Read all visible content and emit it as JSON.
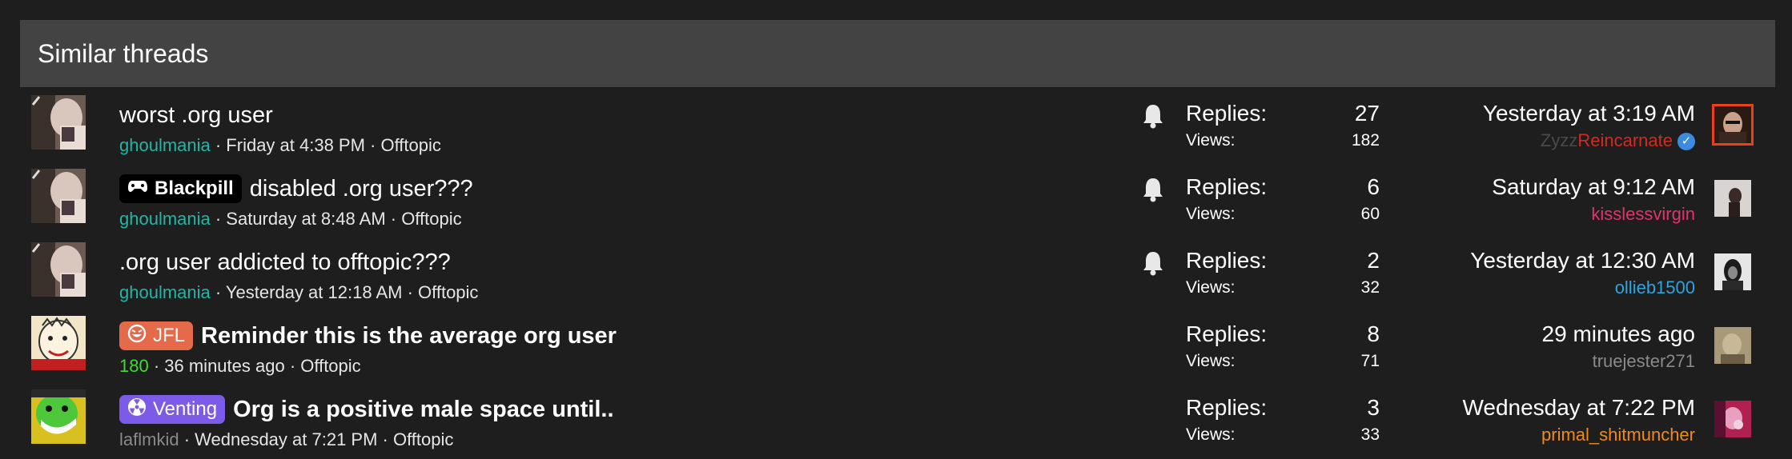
{
  "header": {
    "title": "Similar threads"
  },
  "labels": {
    "replies": "Replies:",
    "views": "Views:"
  },
  "threads": [
    {
      "title": "worst .org user",
      "author": "ghoulmania",
      "meta_rest": " · Friday at 4:38 PM · Offtopic",
      "replies": "27",
      "views": "182",
      "last_date": "Yesterday at 3:19 AM",
      "last_user_a": "Zyzz",
      "last_user_b": "Reincarnate",
      "colors": {
        "author": "#22b5a5",
        "last_user_a": "#4a4a4a",
        "last_user_b": "#d42a1f"
      }
    },
    {
      "prefix": "Blackpill",
      "title": "disabled .org user???",
      "author": "ghoulmania",
      "meta_rest": " · Saturday at 8:48 AM · Offtopic",
      "replies": "6",
      "views": "60",
      "last_date": "Saturday at 9:12 AM",
      "last_user": "kisslessvirgin",
      "colors": {
        "author": "#22b5a5",
        "last_user": "#e0356a",
        "prefix_bg": "#000000"
      }
    },
    {
      "title": ".org user addicted to offtopic???",
      "author": "ghoulmania",
      "meta_rest": " · Yesterday at 12:18 AM · Offtopic",
      "replies": "2",
      "views": "32",
      "last_date": "Yesterday at 12:30 AM",
      "last_user": "ollieb1500",
      "colors": {
        "author": "#22b5a5",
        "last_user": "#2aa5e0"
      }
    },
    {
      "prefix": "JFL",
      "title": "Reminder this is the average org user",
      "author": "180",
      "meta_rest": " · 36 minutes ago · Offtopic",
      "replies": "8",
      "views": "71",
      "last_date": "29 minutes ago",
      "last_user": "truejester271",
      "colors": {
        "author": "#3ddc2e",
        "last_user": "#8a8a8a",
        "prefix_bg": "#e46a4a"
      }
    },
    {
      "prefix": "Venting",
      "title": "Org is a positive male space until..",
      "author": "laflmkid",
      "meta_rest": " · Wednesday at 7:21 PM · Offtopic",
      "replies": "3",
      "views": "33",
      "last_date": "Wednesday at 7:22 PM",
      "last_user": "primal_shitmuncher",
      "colors": {
        "author": "#8a8a8a",
        "last_user": "#f08a1a",
        "prefix_bg": "#7b5be8"
      }
    }
  ]
}
